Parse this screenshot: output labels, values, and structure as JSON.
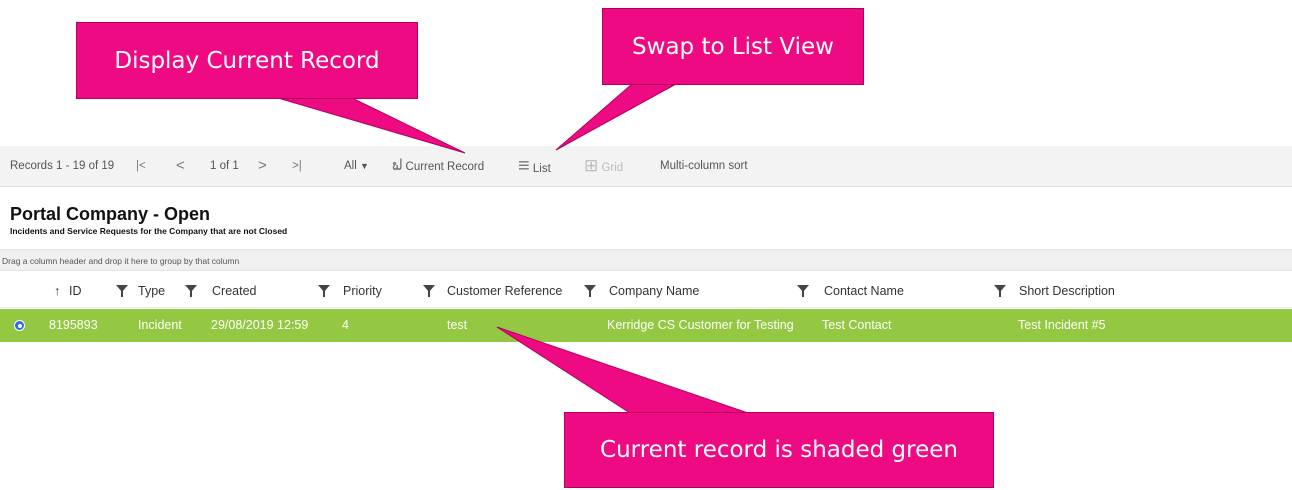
{
  "callouts": {
    "display_current_record": "Display Current Record",
    "swap_to_list_view": "Swap to List View",
    "current_record_shaded": "Current record is shaded green"
  },
  "toolbar": {
    "records_label": "Records 1 - 19 of 19",
    "first_icon": "|<",
    "prev_icon": "<",
    "page_label": "1 of 1",
    "next_icon": ">",
    "last_icon": ">|",
    "filter_all": "All",
    "filter_caret": "▼",
    "binoculars_glyph": "ຟ",
    "current_record": "Current Record",
    "list_glyph": "≡",
    "list": "List",
    "grid_glyph": "⊞",
    "grid": "Grid",
    "multi_sort": "Multi-column sort"
  },
  "view": {
    "title": "Portal Company - Open",
    "subtitle": "Incidents and Service Requests for the Company that are not Closed",
    "group_hint": "Drag a column header and drop it here to group by that column"
  },
  "table": {
    "sort_arrow": "↑",
    "columns": [
      "ID",
      "Type",
      "Created",
      "Priority",
      "Customer Reference",
      "Company Name",
      "Contact Name",
      "Short Description"
    ],
    "rows": [
      {
        "selected": true,
        "cells": [
          "8195893",
          "Incident",
          "29/08/2019 12:59",
          "4",
          "test",
          "Kerridge CS Customer for Testing",
          "Test Contact",
          "Test Incident #5"
        ]
      }
    ]
  },
  "colors": {
    "callout": "#ee0a82",
    "selected_row": "#94c843",
    "radio": "#2a6fdb"
  }
}
